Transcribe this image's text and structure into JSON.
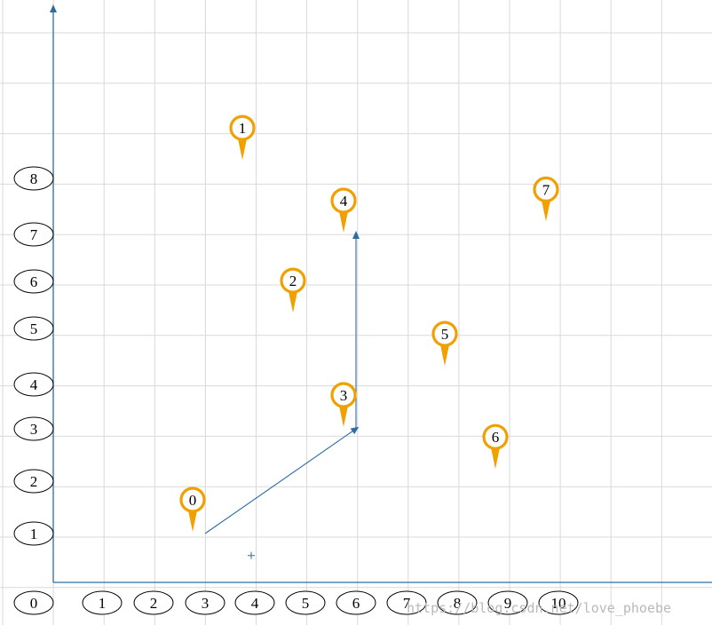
{
  "chart_data": {
    "type": "scatter",
    "x_ticks": [
      "0",
      "1",
      "2",
      "3",
      "4",
      "5",
      "6",
      "7",
      "8",
      "9",
      "10"
    ],
    "y_ticks": [
      "1",
      "2",
      "3",
      "4",
      "5",
      "6",
      "7",
      "8"
    ],
    "points": [
      {
        "label": "0",
        "x": 3,
        "y": 1
      },
      {
        "label": "1",
        "x": 4,
        "y": 8.3
      },
      {
        "label": "2",
        "x": 5,
        "y": 5.3
      },
      {
        "label": "3",
        "x": 6,
        "y": 3
      },
      {
        "label": "4",
        "x": 6,
        "y": 7
      },
      {
        "label": "5",
        "x": 8,
        "y": 4.3
      },
      {
        "label": "6",
        "x": 9,
        "y": 2.2
      },
      {
        "label": "7",
        "x": 10,
        "y": 7.2
      }
    ],
    "path": [
      {
        "x": 3,
        "y": 1
      },
      {
        "x": 6,
        "y": 3
      },
      {
        "x": 6,
        "y": 7
      }
    ],
    "marker": {
      "x": 4,
      "y": 0.55
    },
    "grid": true,
    "accent_color": "#f0a000",
    "axis_color": "#2e6da4"
  },
  "watermark": "https://blog.csdn.net/love_phoebe"
}
